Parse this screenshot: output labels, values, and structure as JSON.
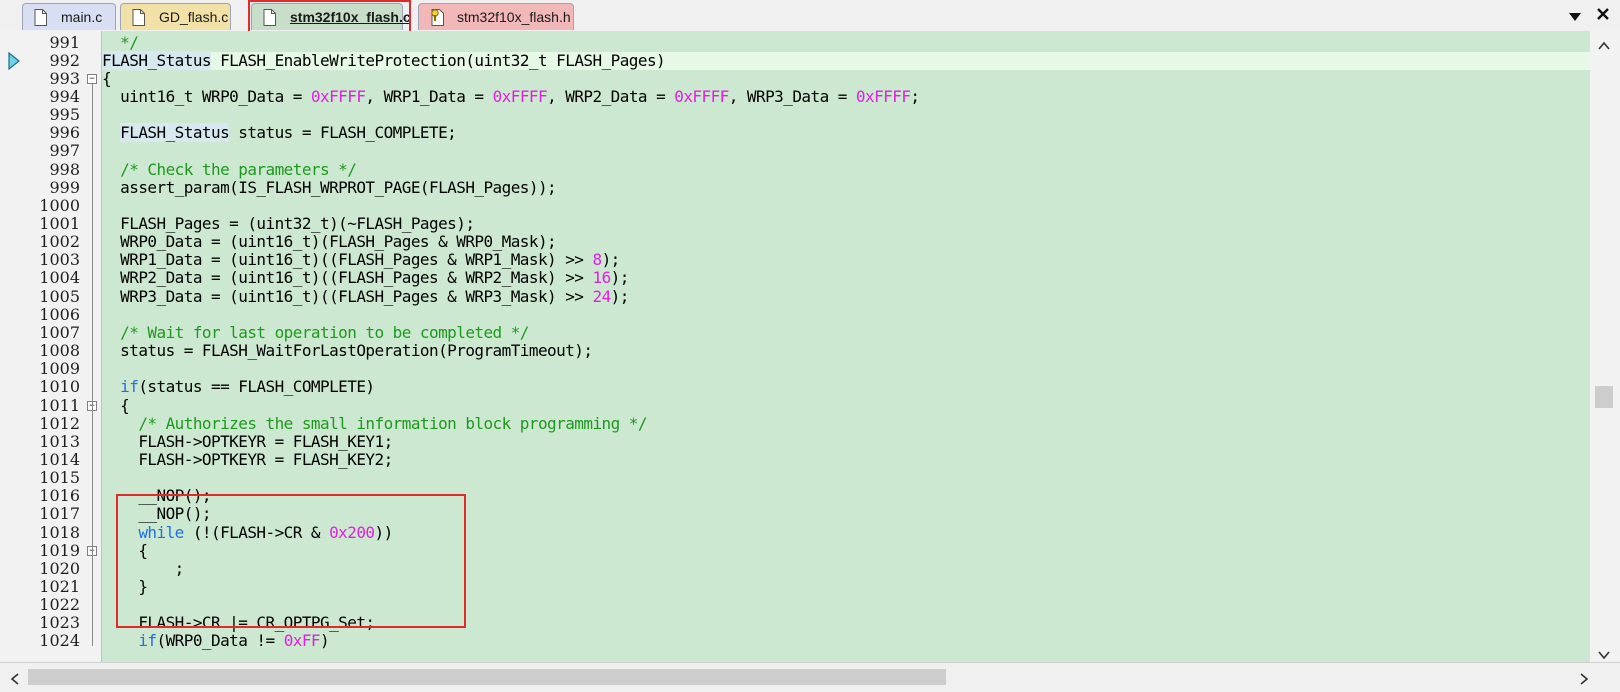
{
  "tabs": [
    {
      "label": "main.c",
      "icon": "document-icon"
    },
    {
      "label": "GD_flash.c",
      "icon": "document-icon"
    },
    {
      "label": "stm32f10x_flash.c",
      "icon": "document-icon",
      "active": true
    },
    {
      "label": "stm32f10x_flash.h",
      "icon": "header-file-icon"
    }
  ],
  "colors": {
    "editor_background": "#cde8d0",
    "comment": "#1c9a1c",
    "number": "#e020e0",
    "keyword": "#1f6fe8",
    "highlight_box": "#e12a2a"
  },
  "editor": {
    "current_line": "992",
    "lines": [
      {
        "num": "991",
        "tokens": [
          {
            "t": "  */",
            "c": "comment"
          }
        ]
      },
      {
        "num": "992",
        "tokens": [
          {
            "t": "FLASH_Status",
            "c": "type-hl"
          },
          {
            "t": " FLASH_EnableWriteProtection(uint32_t FLASH_Pages)",
            "c": ""
          }
        ]
      },
      {
        "num": "993",
        "tokens": [
          {
            "t": "{",
            "c": ""
          }
        ],
        "fold": "minus"
      },
      {
        "num": "994",
        "tokens": [
          {
            "t": "  uint16_t WRP0_Data = ",
            "c": ""
          },
          {
            "t": "0xFFFF",
            "c": "num"
          },
          {
            "t": ", WRP1_Data = ",
            "c": ""
          },
          {
            "t": "0xFFFF",
            "c": "num"
          },
          {
            "t": ", WRP2_Data = ",
            "c": ""
          },
          {
            "t": "0xFFFF",
            "c": "num"
          },
          {
            "t": ", WRP3_Data = ",
            "c": ""
          },
          {
            "t": "0xFFFF",
            "c": "num"
          },
          {
            "t": ";",
            "c": ""
          }
        ]
      },
      {
        "num": "995",
        "tokens": []
      },
      {
        "num": "996",
        "tokens": [
          {
            "t": "  ",
            "c": ""
          },
          {
            "t": "FLASH_Status",
            "c": "type-hl"
          },
          {
            "t": " status = FLASH_COMPLETE;",
            "c": ""
          }
        ]
      },
      {
        "num": "997",
        "tokens": []
      },
      {
        "num": "998",
        "tokens": [
          {
            "t": "  /* Check the parameters */",
            "c": "comment"
          }
        ]
      },
      {
        "num": "999",
        "tokens": [
          {
            "t": "  assert_param(IS_FLASH_WRPROT_PAGE(FLASH_Pages));",
            "c": ""
          }
        ]
      },
      {
        "num": "1000",
        "tokens": []
      },
      {
        "num": "1001",
        "tokens": [
          {
            "t": "  FLASH_Pages = (uint32_t)(~FLASH_Pages);",
            "c": ""
          }
        ]
      },
      {
        "num": "1002",
        "tokens": [
          {
            "t": "  WRP0_Data = (uint16_t)(FLASH_Pages & WRP0_Mask);",
            "c": ""
          }
        ]
      },
      {
        "num": "1003",
        "tokens": [
          {
            "t": "  WRP1_Data = (uint16_t)((FLASH_Pages & WRP1_Mask) >> ",
            "c": ""
          },
          {
            "t": "8",
            "c": "num"
          },
          {
            "t": ");",
            "c": ""
          }
        ]
      },
      {
        "num": "1004",
        "tokens": [
          {
            "t": "  WRP2_Data = (uint16_t)((FLASH_Pages & WRP2_Mask) >> ",
            "c": ""
          },
          {
            "t": "16",
            "c": "num"
          },
          {
            "t": ");",
            "c": ""
          }
        ]
      },
      {
        "num": "1005",
        "tokens": [
          {
            "t": "  WRP3_Data = (uint16_t)((FLASH_Pages & WRP3_Mask) >> ",
            "c": ""
          },
          {
            "t": "24",
            "c": "num"
          },
          {
            "t": ");",
            "c": ""
          }
        ]
      },
      {
        "num": "1006",
        "tokens": []
      },
      {
        "num": "1007",
        "tokens": [
          {
            "t": "  /* Wait for last operation to be completed */",
            "c": "comment"
          }
        ]
      },
      {
        "num": "1008",
        "tokens": [
          {
            "t": "  status = FLASH_WaitForLastOperation(ProgramTimeout);",
            "c": ""
          }
        ]
      },
      {
        "num": "1009",
        "tokens": []
      },
      {
        "num": "1010",
        "tokens": [
          {
            "t": "  ",
            "c": ""
          },
          {
            "t": "if",
            "c": "kw"
          },
          {
            "t": "(status == FLASH_COMPLETE)",
            "c": ""
          }
        ]
      },
      {
        "num": "1011",
        "tokens": [
          {
            "t": "  {",
            "c": ""
          }
        ],
        "fold": "minus"
      },
      {
        "num": "1012",
        "tokens": [
          {
            "t": "    /* Authorizes the small information block programming */",
            "c": "comment"
          }
        ]
      },
      {
        "num": "1013",
        "tokens": [
          {
            "t": "    FLASH->OPTKEYR = FLASH_KEY1;",
            "c": ""
          }
        ]
      },
      {
        "num": "1014",
        "tokens": [
          {
            "t": "    FLASH->OPTKEYR = FLASH_KEY2;",
            "c": ""
          }
        ]
      },
      {
        "num": "1015",
        "tokens": []
      },
      {
        "num": "1016",
        "tokens": [
          {
            "t": "    __NOP();",
            "c": ""
          }
        ]
      },
      {
        "num": "1017",
        "tokens": [
          {
            "t": "    __NOP();",
            "c": ""
          }
        ]
      },
      {
        "num": "1018",
        "tokens": [
          {
            "t": "    ",
            "c": ""
          },
          {
            "t": "while",
            "c": "kw"
          },
          {
            "t": " (!(FLASH->CR & ",
            "c": ""
          },
          {
            "t": "0x200",
            "c": "num"
          },
          {
            "t": "))",
            "c": ""
          }
        ]
      },
      {
        "num": "1019",
        "tokens": [
          {
            "t": "    {",
            "c": ""
          }
        ],
        "fold": "minus"
      },
      {
        "num": "1020",
        "tokens": [
          {
            "t": "        ;",
            "c": ""
          }
        ]
      },
      {
        "num": "1021",
        "tokens": [
          {
            "t": "    }",
            "c": ""
          }
        ]
      },
      {
        "num": "1022",
        "tokens": []
      },
      {
        "num": "1023",
        "tokens": [
          {
            "t": "    FLASH->CR |= CR_OPTPG_Set;",
            "c": ""
          }
        ]
      },
      {
        "num": "1024",
        "tokens": [
          {
            "t": "    ",
            "c": ""
          },
          {
            "t": "if",
            "c": "kw"
          },
          {
            "t": "(WRP0_Data != ",
            "c": ""
          },
          {
            "t": "0xFF",
            "c": "num"
          },
          {
            "t": ")",
            "c": ""
          }
        ]
      }
    ]
  },
  "scroll": {
    "vertical_fraction": 0.58,
    "horizontal_fraction": 0.0
  }
}
